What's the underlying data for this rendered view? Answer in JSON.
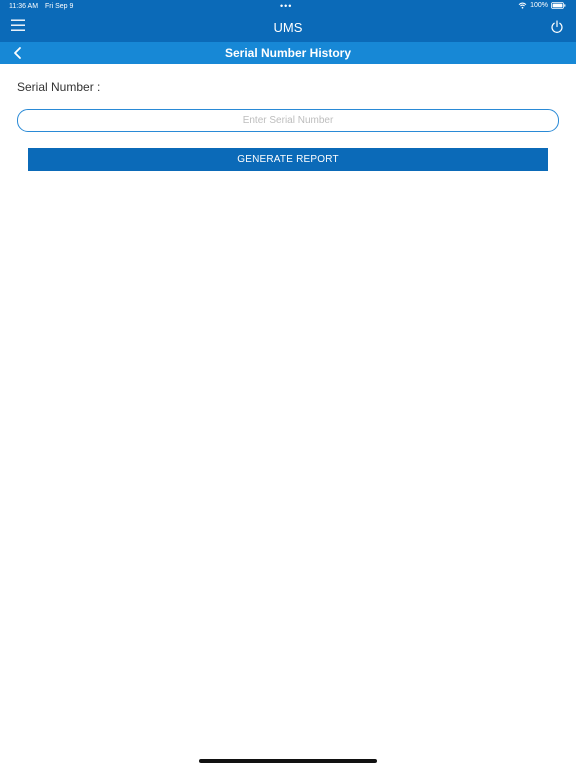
{
  "status_bar": {
    "time": "11:36 AM",
    "date": "Fri Sep 9",
    "dots": "•••",
    "battery": "100%",
    "wifi_icon": "wifi-icon",
    "battery_icon": "battery-icon"
  },
  "header": {
    "title": "UMS",
    "menu_icon": "hamburger-menu-icon",
    "power_icon": "power-icon"
  },
  "sub_header": {
    "title": "Serial Number History",
    "back_icon": "chevron-left-icon"
  },
  "form": {
    "serial_label": "Serial Number :",
    "serial_value": "",
    "serial_placeholder": "Enter Serial Number",
    "generate_label": "GENERATE REPORT"
  },
  "colors": {
    "header_blue": "#0b6ab8",
    "subheader_blue": "#1788d6",
    "input_border": "#2a8ad6"
  }
}
